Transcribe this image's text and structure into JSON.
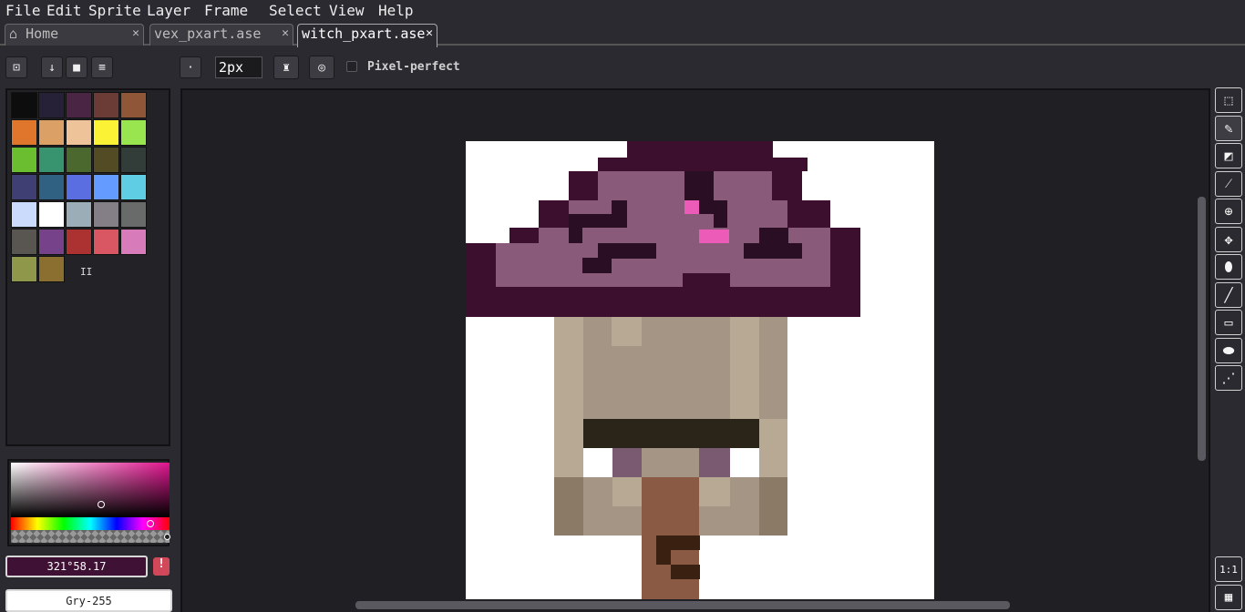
{
  "menu": [
    {
      "label": "File"
    },
    {
      "label": "Edit"
    },
    {
      "label": "Sprite"
    },
    {
      "label": "Layer"
    },
    {
      "label": "Frame"
    },
    {
      "label": "Select"
    },
    {
      "label": "View"
    },
    {
      "label": "Help"
    }
  ],
  "tabs": [
    {
      "label": "Home",
      "icon": "home-icon",
      "active": false
    },
    {
      "label": "vex_pxart.ase",
      "active": false
    },
    {
      "label": "witch_pxart.ase",
      "active": true
    }
  ],
  "context_bar": {
    "brush_size": "2px",
    "pixel_perfect_label": "Pixel-perfect",
    "pixel_perfect_checked": false
  },
  "palette": {
    "colors": [
      "#0d0d0d",
      "#262136",
      "#4a2544",
      "#6b3b36",
      "#8f5637",
      "#e0762c",
      "#dba066",
      "#eec39a",
      "#fbf236",
      "#99e550",
      "#6abe30",
      "#37946e",
      "#4b692f",
      "#524b24",
      "#323c39",
      "#3f3f74",
      "#306082",
      "#5b6ee1",
      "#639bff",
      "#5fcde4",
      "#cbdbfc",
      "#ffffff",
      "#9badb7",
      "#847e87",
      "#696a6a",
      "#595652",
      "#76428a",
      "#ac3232",
      "#d95763",
      "#d77bba",
      "#8f974a",
      "#8a6f30"
    ],
    "pause_glyph": "II"
  },
  "color_picker": {
    "foreground_value": "321°58.17",
    "background_value": "Gry-255",
    "warning_glyph": "!"
  },
  "canvas": {
    "background": "#ffffff",
    "colors": {
      "hat_dark": "#3b0f2d",
      "hat_mid": "#8a5a7b",
      "hat_shadow": "#2a0f24",
      "pink": "#ec5bb8",
      "skin": "#a59585",
      "skin_light": "#b8a995",
      "skin_dark": "#8a7a66",
      "brow": "#2a2419",
      "eye_purple": "#7a5a70",
      "nose": "#8b5a45",
      "mouth": "#3a2010"
    }
  },
  "toolbar": {
    "tools": [
      {
        "name": "marquee-tool",
        "glyph": "⬚"
      },
      {
        "name": "pencil-tool",
        "glyph": "✎"
      },
      {
        "name": "eraser-tool",
        "glyph": "◩"
      },
      {
        "name": "eyedropper-tool",
        "glyph": "⁄"
      },
      {
        "name": "zoom-tool",
        "glyph": "⊕"
      },
      {
        "name": "move-tool",
        "glyph": "✥"
      },
      {
        "name": "fill-tool",
        "glyph": "⬮"
      },
      {
        "name": "line-tool",
        "glyph": "╱"
      },
      {
        "name": "rectangle-tool",
        "glyph": "▭"
      },
      {
        "name": "contour-tool",
        "glyph": "⬬"
      },
      {
        "name": "blur-tool",
        "glyph": "⋰"
      }
    ],
    "zoom_actual_label": "1:1",
    "timeline_glyph": "▦"
  }
}
